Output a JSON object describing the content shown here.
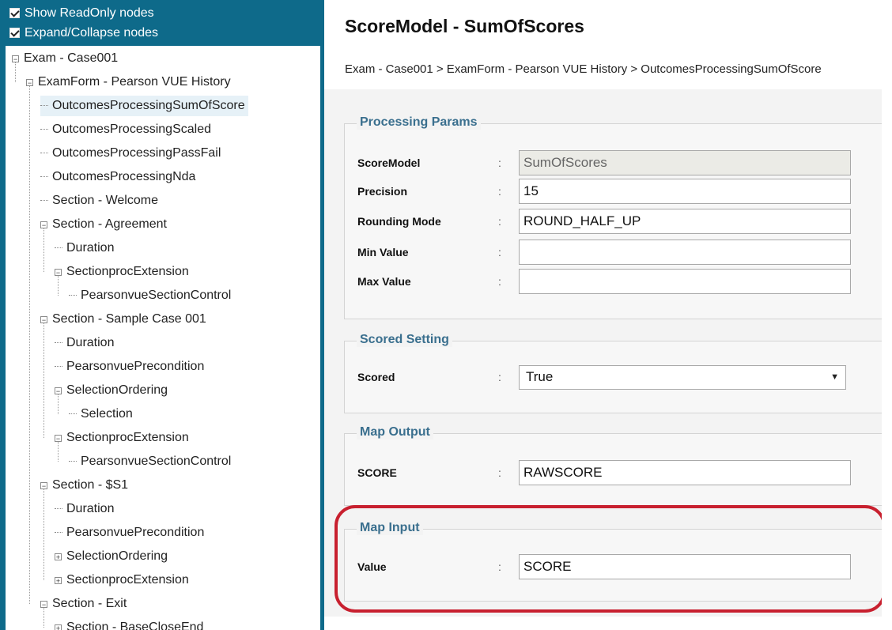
{
  "options": {
    "show_readonly": "Show ReadOnly nodes",
    "expand_collapse": "Expand/Collapse nodes"
  },
  "tree": [
    {
      "label": "Exam - Case001",
      "level": 0,
      "toggle": "minus",
      "selected": false
    },
    {
      "label": "ExamForm - Pearson VUE History",
      "level": 1,
      "toggle": "minus",
      "selected": false
    },
    {
      "label": "OutcomesProcessingSumOfScore",
      "level": 2,
      "toggle": "line",
      "selected": true
    },
    {
      "label": "OutcomesProcessingScaled",
      "level": 2,
      "toggle": "line",
      "selected": false
    },
    {
      "label": "OutcomesProcessingPassFail",
      "level": 2,
      "toggle": "line",
      "selected": false
    },
    {
      "label": "OutcomesProcessingNda",
      "level": 2,
      "toggle": "line",
      "selected": false
    },
    {
      "label": "Section - Welcome",
      "level": 2,
      "toggle": "line",
      "selected": false
    },
    {
      "label": "Section - Agreement",
      "level": 2,
      "toggle": "minus",
      "selected": false
    },
    {
      "label": "Duration",
      "level": 3,
      "toggle": "line",
      "selected": false
    },
    {
      "label": "SectionprocExtension",
      "level": 3,
      "toggle": "minus",
      "selected": false
    },
    {
      "label": "PearsonvueSectionControl",
      "level": 4,
      "toggle": "line",
      "selected": false
    },
    {
      "label": "Section - Sample Case 001",
      "level": 2,
      "toggle": "minus",
      "selected": false
    },
    {
      "label": "Duration",
      "level": 3,
      "toggle": "line",
      "selected": false
    },
    {
      "label": "PearsonvuePrecondition",
      "level": 3,
      "toggle": "line",
      "selected": false
    },
    {
      "label": "SelectionOrdering",
      "level": 3,
      "toggle": "minus",
      "selected": false
    },
    {
      "label": "Selection",
      "level": 4,
      "toggle": "line",
      "selected": false
    },
    {
      "label": "SectionprocExtension",
      "level": 3,
      "toggle": "minus",
      "selected": false
    },
    {
      "label": "PearsonvueSectionControl",
      "level": 4,
      "toggle": "line",
      "selected": false
    },
    {
      "label": "Section - $S1",
      "level": 2,
      "toggle": "minus",
      "selected": false
    },
    {
      "label": "Duration",
      "level": 3,
      "toggle": "line",
      "selected": false
    },
    {
      "label": "PearsonvuePrecondition",
      "level": 3,
      "toggle": "line",
      "selected": false
    },
    {
      "label": "SelectionOrdering",
      "level": 3,
      "toggle": "plus",
      "selected": false
    },
    {
      "label": "SectionprocExtension",
      "level": 3,
      "toggle": "plus",
      "selected": false
    },
    {
      "label": "Section - Exit",
      "level": 2,
      "toggle": "minus",
      "selected": false
    },
    {
      "label": "Section - BaseCloseEnd",
      "level": 3,
      "toggle": "plus",
      "selected": false
    }
  ],
  "header": {
    "title": "ScoreModel - SumOfScores",
    "breadcrumb": "Exam - Case001 > ExamForm - Pearson VUE History > OutcomesProcessingSumOfScore"
  },
  "processing_params": {
    "legend": "Processing Params",
    "score_model_label": "ScoreModel",
    "score_model_value": "SumOfScores",
    "precision_label": "Precision",
    "precision_value": "15",
    "rounding_mode_label": "Rounding Mode",
    "rounding_mode_value": "ROUND_HALF_UP",
    "min_value_label": "Min Value",
    "min_value_value": "",
    "max_value_label": "Max Value",
    "max_value_value": ""
  },
  "scored_setting": {
    "legend": "Scored Setting",
    "scored_label": "Scored",
    "scored_value": "True"
  },
  "map_output": {
    "legend": "Map Output",
    "score_label": "SCORE",
    "score_value": "RAWSCORE"
  },
  "map_input": {
    "legend": "Map Input",
    "value_label": "Value",
    "value_value": "SCORE"
  },
  "colors": {
    "panel_teal": "#0e6a8a",
    "legend_blue": "#3a6f8e",
    "highlight_red": "#c8202f"
  },
  "separator": ":"
}
